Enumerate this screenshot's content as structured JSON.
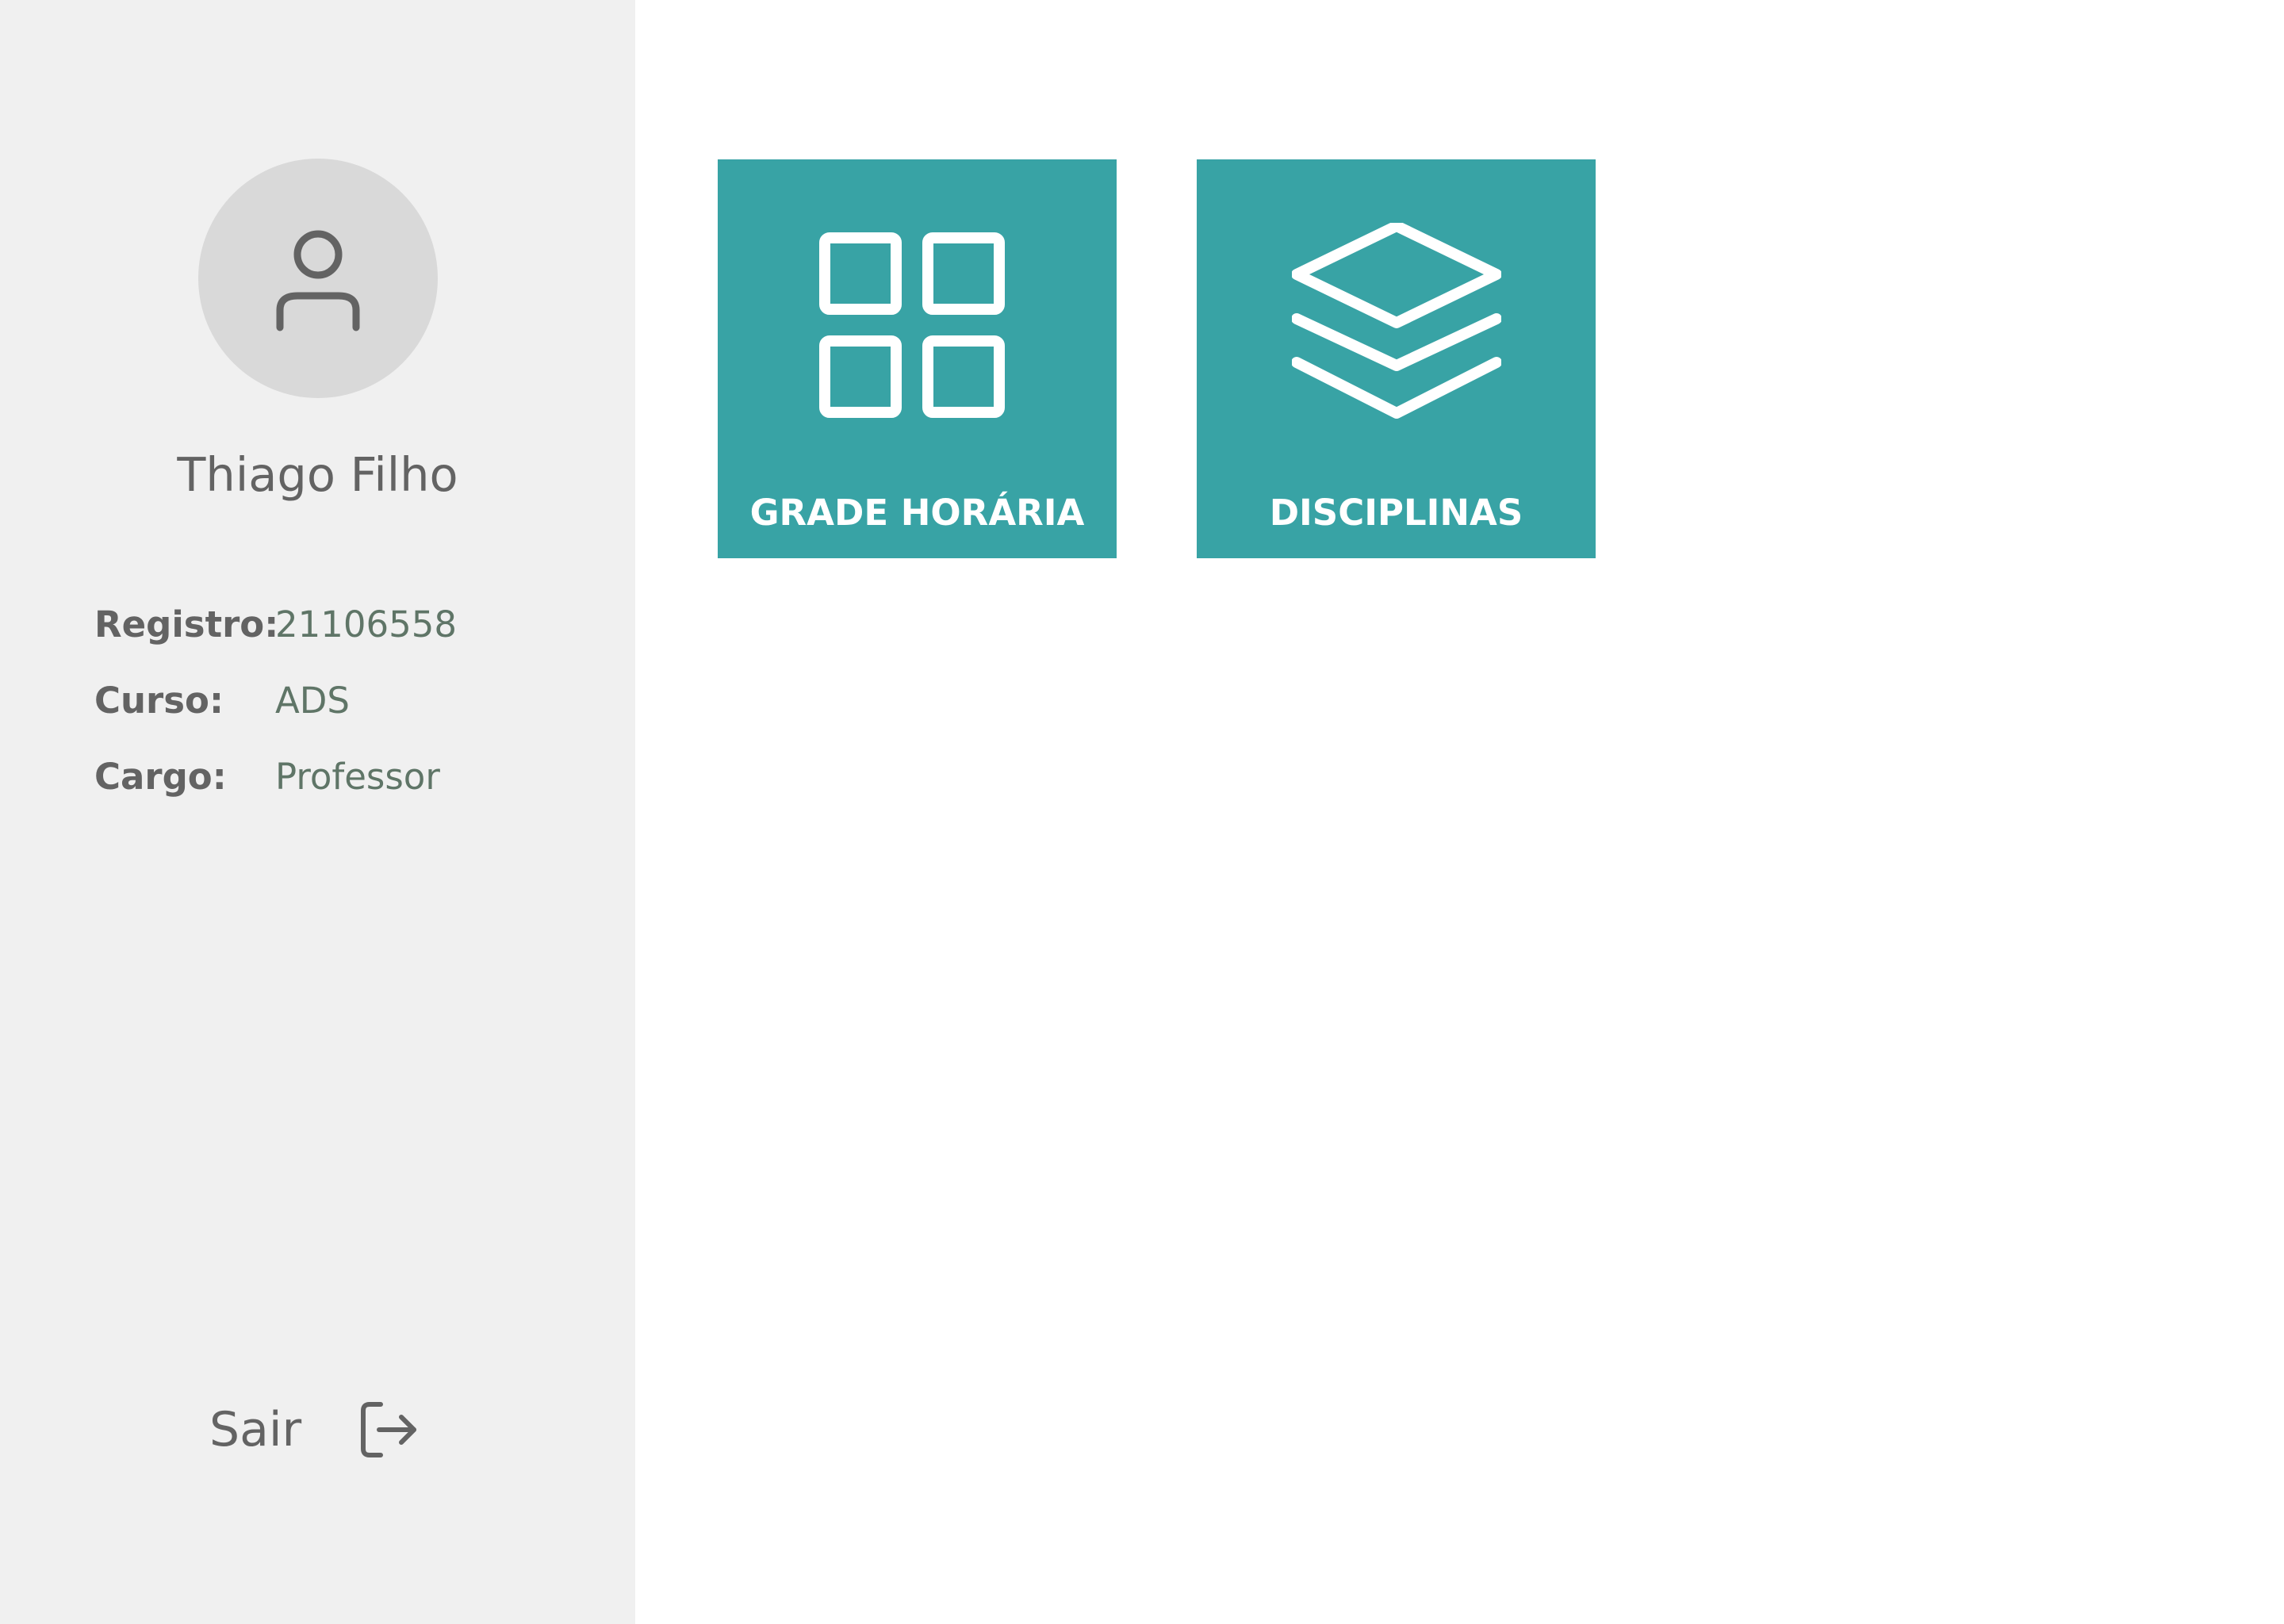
{
  "user": {
    "name": "Thiago Filho",
    "avatar_icon": "user-icon"
  },
  "info": [
    {
      "label": "Registro:",
      "value": "21106558"
    },
    {
      "label": "Curso:",
      "value": "ADS"
    },
    {
      "label": "Cargo:",
      "value": "Professor"
    }
  ],
  "logout": {
    "label": "Sair",
    "icon": "logout-icon"
  },
  "tiles": [
    {
      "label": "GRADE HORÁRIA",
      "icon": "grid-icon"
    },
    {
      "label": "DISCIPLINAS",
      "icon": "layers-icon"
    }
  ],
  "colors": {
    "accent": "#38a3a5",
    "sidebar_bg": "#f0f0f0",
    "avatar_bg": "#d9d9d9",
    "text_gray": "#636363",
    "value_green": "#5f7567"
  }
}
